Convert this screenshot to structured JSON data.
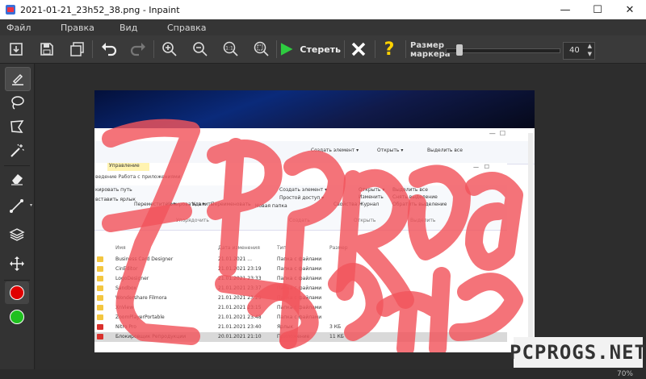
{
  "window": {
    "title": "2021-01-21_23h52_38.png - Inpaint",
    "controls": [
      "—",
      "☐",
      "✕"
    ]
  },
  "menu": {
    "items": [
      "Файл",
      "Правка",
      "Вид",
      "Справка"
    ]
  },
  "toolbar": {
    "erase_label": "Стереть",
    "size_label_line1": "Размер",
    "size_label_line2": "маркера",
    "marker_size": "40",
    "marker_size_fraction": 0.1
  },
  "status": {
    "zoom": "70%"
  },
  "watermark": "PCPROGS.NET",
  "colors": {
    "accent_green": "#2ecc40",
    "color_red": "#e00000",
    "color_green": "#1fc01f",
    "mask_red": "#f2545b",
    "help_yellow": "#ffd200"
  },
  "screenshot": {
    "ribbon_top": {
      "labels": [
        "Создать элемент ▾",
        "Открыть ▾",
        "Выделить все"
      ]
    },
    "tab_label": "Управление",
    "ribbon_tab_row": "ведение  Работа с приложениями",
    "ribbon": {
      "copy_path": "кировать путь",
      "paste_shortcut": "вставить ярлык",
      "move_to": "Переместить в ▾",
      "copy_to": "Копировать в ▾",
      "delete": "Удалить",
      "rename": "Переименовать",
      "new_folder": "Новая папка",
      "new_item": "Создать элемент ▾",
      "easy_access": "Простой доступ ▾",
      "properties": "Свойства",
      "open": "Открыть ▾",
      "edit": "Изменить",
      "history": "Журнал",
      "select_all": "Выделить все",
      "select_none": "Снять выделение",
      "invert_selection": "Обратить выделение",
      "group_organize": "Упорядочить",
      "group_new": "Создать",
      "group_open": "Открыть",
      "group_select": "Выделить"
    },
    "columns": [
      "Имя",
      "Дата изменения",
      "Тип",
      "Размер"
    ],
    "files": [
      {
        "name": "Business Card Designer",
        "date": "21.01.2021 ...",
        "type": "Папка с файлами",
        "size": ""
      },
      {
        "name": "CinEditor",
        "date": "21.01.2021 23:19",
        "type": "Папка с файлами",
        "size": ""
      },
      {
        "name": "LogoDesigner",
        "date": "21.01.2021 23:33",
        "type": "Папка с файлами",
        "size": ""
      },
      {
        "name": "Sandbox",
        "date": "21.01.2021 23:37",
        "type": "Папка с файлами",
        "size": ""
      },
      {
        "name": "Wondershare Filmora",
        "date": "21.01.2021 23:29",
        "type": "Папка с файлами",
        "size": ""
      },
      {
        "name": "XnView",
        "date": "21.01.2021 23:15",
        "type": "Папка с файлами",
        "size": ""
      },
      {
        "name": "ZoomPlayerPortable",
        "date": "21.01.2021 23:48",
        "type": "Папка с файлами",
        "size": ""
      },
      {
        "name": "Nitro Pro",
        "date": "21.01.2021 23:40",
        "type": "Ярлык",
        "size": "3 КБ"
      },
      {
        "name": "Блокировщик Репродукции",
        "date": "20.01.2021 21:10",
        "type": "Приложение",
        "size": "11 КБ"
      }
    ]
  }
}
